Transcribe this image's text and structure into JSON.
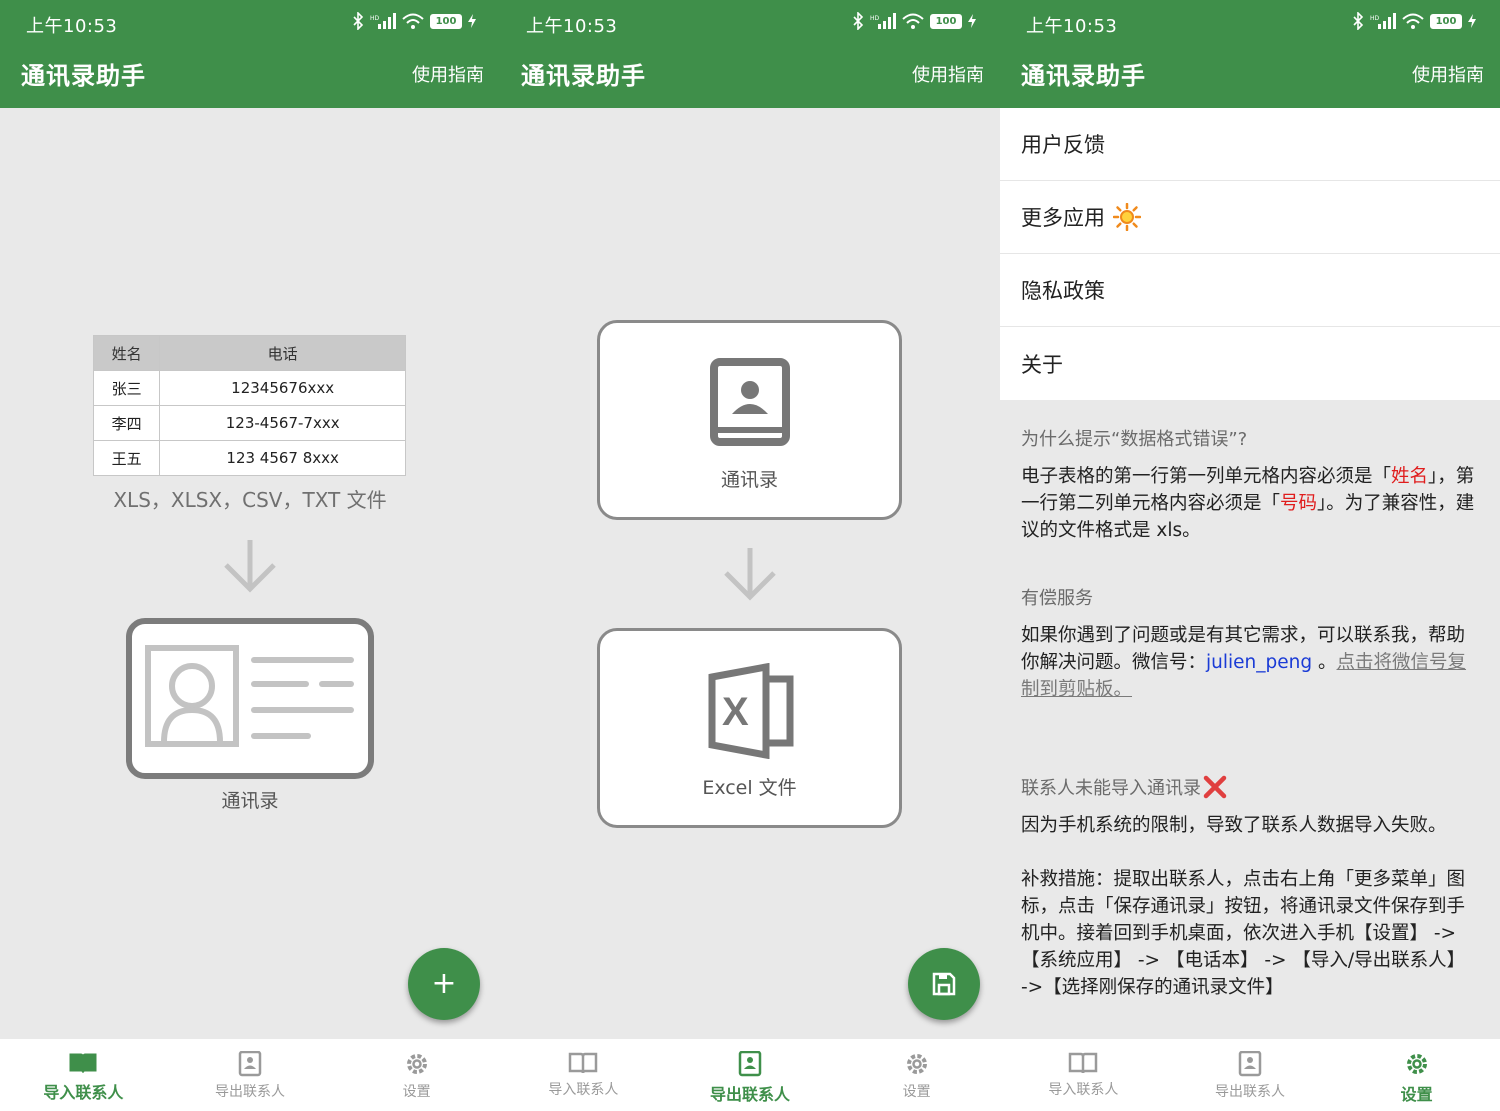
{
  "status": {
    "time": "上午10:53",
    "battery": "100"
  },
  "appbar": {
    "title": "通讯录助手",
    "guide": "使用指南"
  },
  "nav": {
    "import": "导入联系人",
    "export": "导出联系人",
    "settings": "设置"
  },
  "screen1": {
    "table": {
      "headers": [
        "姓名",
        "电话"
      ],
      "rows": [
        [
          "张三",
          "12345676xxx"
        ],
        [
          "李四",
          "123-4567-7xxx"
        ],
        [
          "王五",
          "123 4567 8xxx"
        ]
      ]
    },
    "file_types": "XLS，XLSX，CSV，TXT 文件",
    "caption": "通讯录",
    "fab": "+"
  },
  "screen2": {
    "top_label": "通讯录",
    "bottom_label": "Excel 文件"
  },
  "screen3": {
    "menu": [
      "用户反馈",
      "更多应用",
      "隐私政策",
      "关于"
    ],
    "q1": "为什么提示“数据格式错误”?",
    "a1": {
      "p1": "电子表格的第一行第一列单元格内容必须是「",
      "r1": "姓名",
      "p2": "」，第一行第二列单元格内容必须是「",
      "r2": "号码",
      "p3": "」。为了兼容性，建议的文件格式是 xls。"
    },
    "q2": "有偿服务",
    "a2": {
      "p1": "如果你遇到了问题或是有其它需求，可以联系我，帮助你解决问题。微信号：",
      "wechat": "julien_peng",
      "p2": " 。",
      "link": "点击将微信号复制到剪贴板。"
    },
    "q3": "联系人未能导入通讯录",
    "a3": "因为手机系统的限制，导致了联系人数据导入失败。",
    "a4": "补救措施：提取出联系人，点击右上角「更多菜单」图标，点击「保存通讯录」按钮，将通讯录文件保存到手机中。接着回到手机桌面，依次进入手机【设置】 -> 【系统应用】 -> 【电话本】 -> 【导入/导出联系人】 ->【选择刚保存的通讯录文件】"
  },
  "colors": {
    "primary": "#3f8f4a",
    "alert_red": "#e01d1d",
    "link_blue": "#1a3bd6"
  }
}
